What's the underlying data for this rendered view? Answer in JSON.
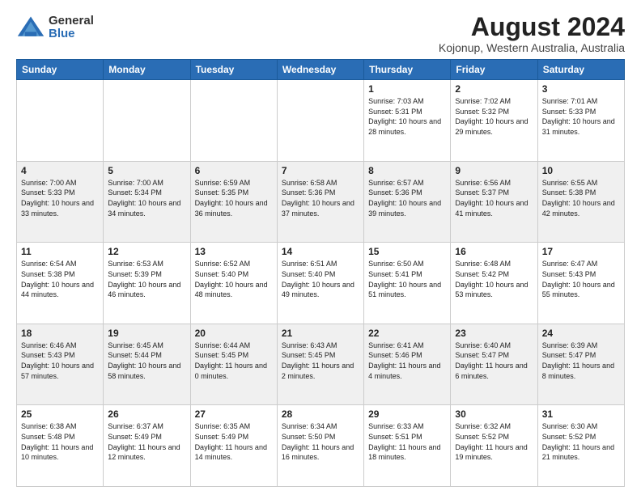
{
  "logo": {
    "general": "General",
    "blue": "Blue"
  },
  "header": {
    "title": "August 2024",
    "subtitle": "Kojonup, Western Australia, Australia"
  },
  "days_of_week": [
    "Sunday",
    "Monday",
    "Tuesday",
    "Wednesday",
    "Thursday",
    "Friday",
    "Saturday"
  ],
  "weeks": [
    [
      {
        "day": "",
        "info": ""
      },
      {
        "day": "",
        "info": ""
      },
      {
        "day": "",
        "info": ""
      },
      {
        "day": "",
        "info": ""
      },
      {
        "day": "1",
        "info": "Sunrise: 7:03 AM\nSunset: 5:31 PM\nDaylight: 10 hours\nand 28 minutes."
      },
      {
        "day": "2",
        "info": "Sunrise: 7:02 AM\nSunset: 5:32 PM\nDaylight: 10 hours\nand 29 minutes."
      },
      {
        "day": "3",
        "info": "Sunrise: 7:01 AM\nSunset: 5:33 PM\nDaylight: 10 hours\nand 31 minutes."
      }
    ],
    [
      {
        "day": "4",
        "info": "Sunrise: 7:00 AM\nSunset: 5:33 PM\nDaylight: 10 hours\nand 33 minutes."
      },
      {
        "day": "5",
        "info": "Sunrise: 7:00 AM\nSunset: 5:34 PM\nDaylight: 10 hours\nand 34 minutes."
      },
      {
        "day": "6",
        "info": "Sunrise: 6:59 AM\nSunset: 5:35 PM\nDaylight: 10 hours\nand 36 minutes."
      },
      {
        "day": "7",
        "info": "Sunrise: 6:58 AM\nSunset: 5:36 PM\nDaylight: 10 hours\nand 37 minutes."
      },
      {
        "day": "8",
        "info": "Sunrise: 6:57 AM\nSunset: 5:36 PM\nDaylight: 10 hours\nand 39 minutes."
      },
      {
        "day": "9",
        "info": "Sunrise: 6:56 AM\nSunset: 5:37 PM\nDaylight: 10 hours\nand 41 minutes."
      },
      {
        "day": "10",
        "info": "Sunrise: 6:55 AM\nSunset: 5:38 PM\nDaylight: 10 hours\nand 42 minutes."
      }
    ],
    [
      {
        "day": "11",
        "info": "Sunrise: 6:54 AM\nSunset: 5:38 PM\nDaylight: 10 hours\nand 44 minutes."
      },
      {
        "day": "12",
        "info": "Sunrise: 6:53 AM\nSunset: 5:39 PM\nDaylight: 10 hours\nand 46 minutes."
      },
      {
        "day": "13",
        "info": "Sunrise: 6:52 AM\nSunset: 5:40 PM\nDaylight: 10 hours\nand 48 minutes."
      },
      {
        "day": "14",
        "info": "Sunrise: 6:51 AM\nSunset: 5:40 PM\nDaylight: 10 hours\nand 49 minutes."
      },
      {
        "day": "15",
        "info": "Sunrise: 6:50 AM\nSunset: 5:41 PM\nDaylight: 10 hours\nand 51 minutes."
      },
      {
        "day": "16",
        "info": "Sunrise: 6:48 AM\nSunset: 5:42 PM\nDaylight: 10 hours\nand 53 minutes."
      },
      {
        "day": "17",
        "info": "Sunrise: 6:47 AM\nSunset: 5:43 PM\nDaylight: 10 hours\nand 55 minutes."
      }
    ],
    [
      {
        "day": "18",
        "info": "Sunrise: 6:46 AM\nSunset: 5:43 PM\nDaylight: 10 hours\nand 57 minutes."
      },
      {
        "day": "19",
        "info": "Sunrise: 6:45 AM\nSunset: 5:44 PM\nDaylight: 10 hours\nand 58 minutes."
      },
      {
        "day": "20",
        "info": "Sunrise: 6:44 AM\nSunset: 5:45 PM\nDaylight: 11 hours\nand 0 minutes."
      },
      {
        "day": "21",
        "info": "Sunrise: 6:43 AM\nSunset: 5:45 PM\nDaylight: 11 hours\nand 2 minutes."
      },
      {
        "day": "22",
        "info": "Sunrise: 6:41 AM\nSunset: 5:46 PM\nDaylight: 11 hours\nand 4 minutes."
      },
      {
        "day": "23",
        "info": "Sunrise: 6:40 AM\nSunset: 5:47 PM\nDaylight: 11 hours\nand 6 minutes."
      },
      {
        "day": "24",
        "info": "Sunrise: 6:39 AM\nSunset: 5:47 PM\nDaylight: 11 hours\nand 8 minutes."
      }
    ],
    [
      {
        "day": "25",
        "info": "Sunrise: 6:38 AM\nSunset: 5:48 PM\nDaylight: 11 hours\nand 10 minutes."
      },
      {
        "day": "26",
        "info": "Sunrise: 6:37 AM\nSunset: 5:49 PM\nDaylight: 11 hours\nand 12 minutes."
      },
      {
        "day": "27",
        "info": "Sunrise: 6:35 AM\nSunset: 5:49 PM\nDaylight: 11 hours\nand 14 minutes."
      },
      {
        "day": "28",
        "info": "Sunrise: 6:34 AM\nSunset: 5:50 PM\nDaylight: 11 hours\nand 16 minutes."
      },
      {
        "day": "29",
        "info": "Sunrise: 6:33 AM\nSunset: 5:51 PM\nDaylight: 11 hours\nand 18 minutes."
      },
      {
        "day": "30",
        "info": "Sunrise: 6:32 AM\nSunset: 5:52 PM\nDaylight: 11 hours\nand 19 minutes."
      },
      {
        "day": "31",
        "info": "Sunrise: 6:30 AM\nSunset: 5:52 PM\nDaylight: 11 hours\nand 21 minutes."
      }
    ]
  ]
}
